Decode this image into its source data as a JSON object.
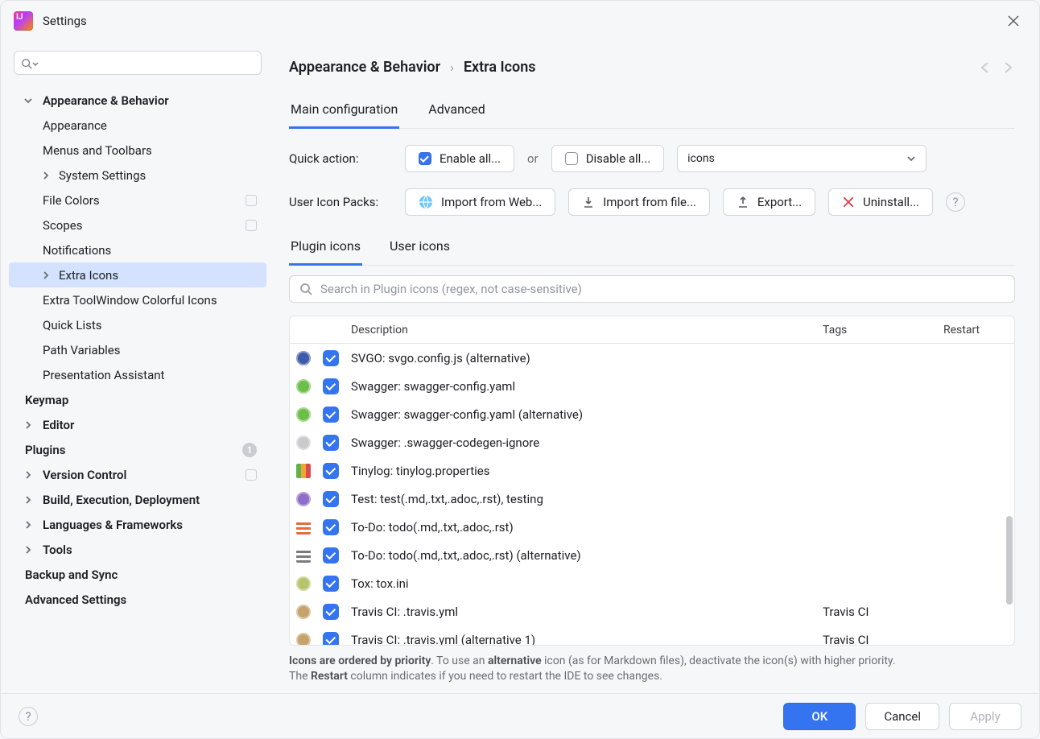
{
  "window": {
    "title": "Settings"
  },
  "sidebar": {
    "search_placeholder": "",
    "items": [
      {
        "label": "Appearance & Behavior",
        "bold": true,
        "depth": 0,
        "expandable": true,
        "expanded": true
      },
      {
        "label": "Appearance",
        "depth": 1
      },
      {
        "label": "Menus and Toolbars",
        "depth": 1
      },
      {
        "label": "System Settings",
        "depth": 1,
        "expandable": true,
        "expanded": false
      },
      {
        "label": "File Colors",
        "depth": 1,
        "badge": "box"
      },
      {
        "label": "Scopes",
        "depth": 1,
        "badge": "box"
      },
      {
        "label": "Notifications",
        "depth": 1
      },
      {
        "label": "Extra Icons",
        "depth": 1,
        "selected": true,
        "expandable": true,
        "expanded": false
      },
      {
        "label": "Extra ToolWindow Colorful Icons",
        "depth": 1
      },
      {
        "label": "Quick Lists",
        "depth": 1
      },
      {
        "label": "Path Variables",
        "depth": 1
      },
      {
        "label": "Presentation Assistant",
        "depth": 1
      },
      {
        "label": "Keymap",
        "bold": true,
        "depth": 0
      },
      {
        "label": "Editor",
        "bold": true,
        "depth": 0,
        "expandable": true,
        "expanded": false
      },
      {
        "label": "Plugins",
        "bold": true,
        "depth": 0,
        "badge_num": "1"
      },
      {
        "label": "Version Control",
        "bold": true,
        "depth": 0,
        "expandable": true,
        "expanded": false,
        "badge": "box"
      },
      {
        "label": "Build, Execution, Deployment",
        "bold": true,
        "depth": 0,
        "expandable": true,
        "expanded": false
      },
      {
        "label": "Languages & Frameworks",
        "bold": true,
        "depth": 0,
        "expandable": true,
        "expanded": false
      },
      {
        "label": "Tools",
        "bold": true,
        "depth": 0,
        "expandable": true,
        "expanded": false
      },
      {
        "label": "Backup and Sync",
        "bold": true,
        "depth": 0
      },
      {
        "label": "Advanced Settings",
        "bold": true,
        "depth": 0
      }
    ]
  },
  "breadcrumb": {
    "root": "Appearance & Behavior",
    "leaf": "Extra Icons"
  },
  "topTabs": [
    {
      "label": "Main configuration",
      "active": true
    },
    {
      "label": "Advanced"
    }
  ],
  "quickAction": {
    "label": "Quick action:",
    "enableAll": "Enable all...",
    "or": "or",
    "disableAll": "Disable all...",
    "selectValue": "icons"
  },
  "iconPacksRow": {
    "label": "User Icon Packs:",
    "importWeb": "Import from Web...",
    "importFile": "Import from file...",
    "export": "Export...",
    "uninstall": "Uninstall..."
  },
  "subTabs": [
    {
      "label": "Plugin icons",
      "active": true
    },
    {
      "label": "User icons"
    }
  ],
  "filter": {
    "placeholder": "Search in Plugin icons (regex, not case-sensitive)"
  },
  "table": {
    "headers": {
      "desc": "Description",
      "tags": "Tags",
      "restart": "Restart"
    },
    "rows": [
      {
        "desc": "SVGO: svgo.config.js (alternative)",
        "tags": "",
        "iconColor": "#3d5ba9",
        "iconShape": "circle"
      },
      {
        "desc": "Swagger: swagger-config.yaml",
        "tags": "",
        "iconColor": "#6cc04a",
        "iconShape": "circle"
      },
      {
        "desc": "Swagger: swagger-config.yaml (alternative)",
        "tags": "",
        "iconColor": "#6cc04a",
        "iconShape": "circle"
      },
      {
        "desc": "Swagger: .swagger-codegen-ignore",
        "tags": "",
        "iconColor": "#c8cacc",
        "iconShape": "circle"
      },
      {
        "desc": "Tinylog: tinylog.properties",
        "tags": "",
        "iconColor": "#61b24d",
        "iconShape": "bar"
      },
      {
        "desc": "Test: test(.md,.txt,.adoc,.rst), testing",
        "tags": "",
        "iconColor": "#8e6fc8",
        "iconShape": "circle"
      },
      {
        "desc": "To-Do: todo(.md,.txt,.adoc,.rst)",
        "tags": "",
        "iconColor": "#e86b3a",
        "iconShape": "list"
      },
      {
        "desc": "To-Do: todo(.md,.txt,.adoc,.rst) (alternative)",
        "tags": "",
        "iconColor": "#7a7c82",
        "iconShape": "list"
      },
      {
        "desc": "Tox: tox.ini",
        "tags": "",
        "iconColor": "#b7c46b",
        "iconShape": "circle"
      },
      {
        "desc": "Travis CI: .travis.yml",
        "tags": "Travis CI",
        "iconColor": "#c7a36b",
        "iconShape": "circle"
      },
      {
        "desc": "Travis CI: .travis.yml (alternative 1)",
        "tags": "Travis CI",
        "iconColor": "#c7a36b",
        "iconShape": "circle"
      }
    ]
  },
  "hint": {
    "span1a": "Icons are ordered by priority",
    "span1b": ". To use an ",
    "span1c": "alternative",
    "span1d": " icon (as for Markdown files), deactivate the icon(s) with higher priority.",
    "span2a": "The ",
    "span2b": "Restart",
    "span2c": " column indicates if you need to restart the IDE to see changes."
  },
  "footer": {
    "ok": "OK",
    "cancel": "Cancel",
    "apply": "Apply"
  }
}
